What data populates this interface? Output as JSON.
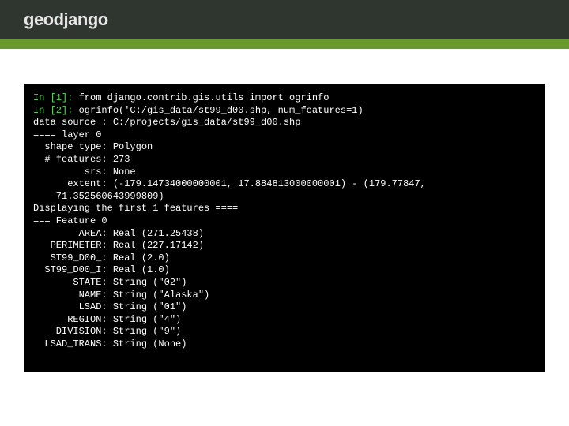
{
  "header": {
    "logo_text": "geodjango"
  },
  "terminal": {
    "prompts": {
      "p1": "In [1]: ",
      "p2": "In [2]: "
    },
    "commands": {
      "c1": "from django.contrib.gis.utils import ogrinfo",
      "c2": "ogrinfo('C:/gis_data/st99_d00.shp, num_features=1)"
    },
    "output_lines": {
      "l01": "data source : C:/projects/gis_data/st99_d00.shp",
      "l02": "==== layer 0",
      "l03": "  shape type: Polygon",
      "l04": "  # features: 273",
      "l05": "         srs: None",
      "l06": "      extent: (-179.14734000000001, 17.884813000000001) - (179.77847,",
      "l07": "    71.352560643999809)",
      "l08": "Displaying the first 1 features ====",
      "l09": "=== Feature 0",
      "l10": "        AREA: Real (271.25438)",
      "l11": "   PERIMETER: Real (227.17142)",
      "l12": "   ST99_D00_: Real (2.0)",
      "l13": "  ST99_D00_I: Real (1.0)",
      "l14": "       STATE: String (\"02\")",
      "l15": "        NAME: String (\"Alaska\")",
      "l16": "        LSAD: String (\"01\")",
      "l17": "      REGION: String (\"4\")",
      "l18": "    DIVISION: String (\"9\")",
      "l19": "  LSAD_TRANS: String (None)"
    }
  }
}
